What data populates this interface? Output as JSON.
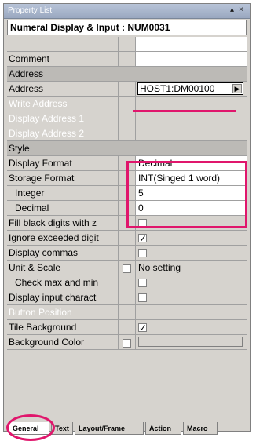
{
  "window": {
    "title": "Property List",
    "pin_icon": "▴",
    "close_icon": "×"
  },
  "header": {
    "object": "Numeral Display & Input : NUM0031"
  },
  "rows": [
    {
      "label": "Comment"
    },
    {
      "section": "Address"
    },
    {
      "label": "Address",
      "value": "HOST1:DM00100"
    },
    {
      "label": "Write Address",
      "disabled": true
    },
    {
      "label": "Display Address 1",
      "disabled": true
    },
    {
      "label": "Display Address 2",
      "disabled": true
    },
    {
      "section": "Style"
    },
    {
      "label": "Display Format",
      "value": "Decimal"
    },
    {
      "label": "Storage Format",
      "value": "INT(Singed 1 word)"
    },
    {
      "label": "Integer",
      "value": "5"
    },
    {
      "label": "Decimal",
      "value": "0"
    },
    {
      "label": "Fill black digits with z",
      "checked": false
    },
    {
      "label": "Ignore exceeded digit",
      "checked": true
    },
    {
      "label": "Display commas",
      "checked": false
    },
    {
      "label": "Unit & Scale",
      "value": "No setting"
    },
    {
      "label": "Check max and min",
      "checked": false
    },
    {
      "label": "Display input charact",
      "checked": false
    },
    {
      "label": "Button Position",
      "disabled": true
    },
    {
      "label": "Tile Background",
      "checked": true
    },
    {
      "label": "Background Color"
    }
  ],
  "tabs": [
    "General",
    "Text",
    "Layout/Frame",
    "Action",
    "Macro"
  ],
  "active_tab": "General",
  "colors": {
    "annotation": "#e0166c"
  }
}
